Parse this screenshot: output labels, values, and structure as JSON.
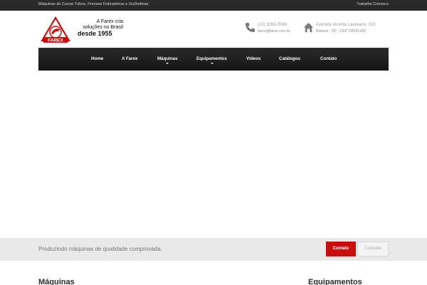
{
  "topbar": {
    "tagline": "Máquinas de Curvar Tubos, Prensas Dobradeiras e Guilhotinas.",
    "work_link": "Trabalhe Conosco"
  },
  "header": {
    "logo_text": "FAREX",
    "slogan": {
      "line1": "A Farex cria",
      "line2": "soluções no Brasil",
      "line3": "desde 1955"
    },
    "phone": {
      "icon": "phone-icon",
      "number": "(15) 3263-5566",
      "email": "farex@farex.com.br"
    },
    "address": {
      "icon": "home-icon",
      "street": "Avenida Vicente Laureano, 216",
      "city": "Boituva - SP - CEP 18550-000"
    }
  },
  "nav": {
    "items": [
      {
        "label": "Home"
      },
      {
        "label": "A Farex"
      },
      {
        "label": "Máquinas"
      },
      {
        "label": "Equipamentos"
      },
      {
        "label": "Vídeos"
      },
      {
        "label": "Catálogos"
      },
      {
        "label": "Contato"
      }
    ]
  },
  "cta": {
    "text": "Produzindo máquinas de qualidade comprovada.",
    "contato_label": "Contato",
    "consulte_label": "Consulte"
  },
  "sections": {
    "maquinas": "Máquinas",
    "equipamentos": "Equipamentos"
  },
  "colors": {
    "brand_red": "#c70d0d",
    "nav_bg": "#1f1f1f",
    "topbar_bg": "#2a2a2a"
  }
}
